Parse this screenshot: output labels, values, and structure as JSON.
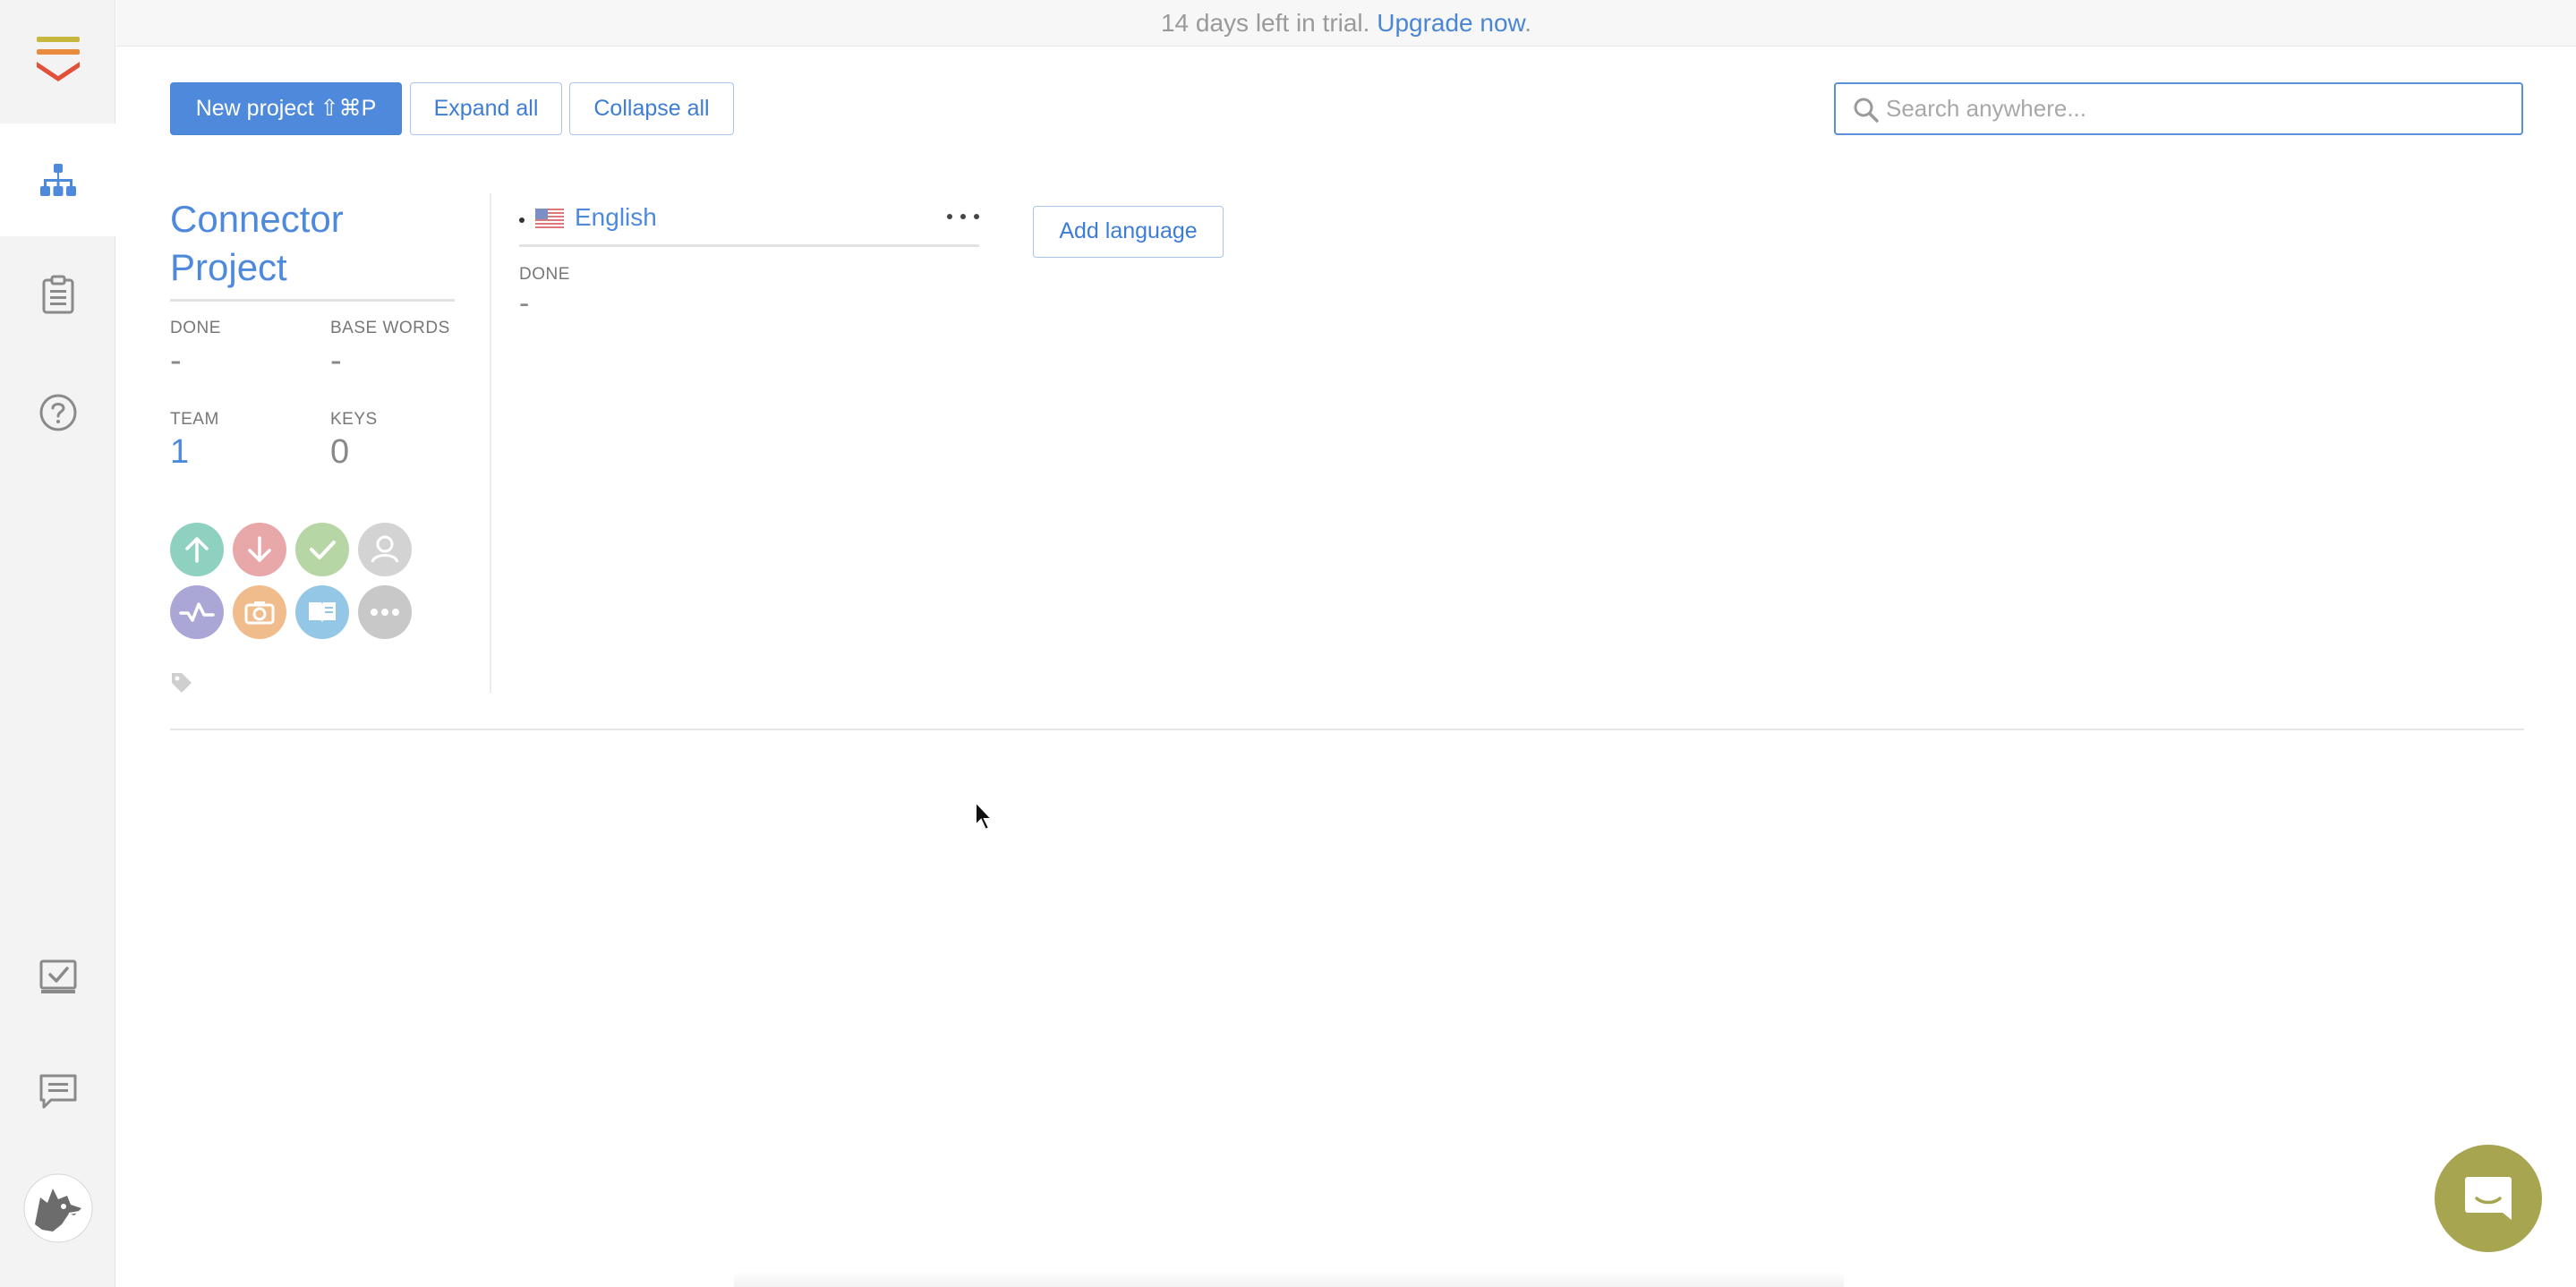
{
  "banner": {
    "trial_text": "14 days left in trial.",
    "upgrade_link": "Upgrade now",
    "trailing": "."
  },
  "toolbar": {
    "new_project_label": "New project ⇧⌘P",
    "expand_all_label": "Expand all",
    "collapse_all_label": "Collapse all"
  },
  "search": {
    "placeholder": "Search anywhere..."
  },
  "sidebar": {
    "items": [
      {
        "name": "projects",
        "icon": "sitemap-icon",
        "active": true
      },
      {
        "name": "orders",
        "icon": "clipboard-icon",
        "active": false
      },
      {
        "name": "help",
        "icon": "question-icon",
        "active": false
      },
      {
        "name": "tasks",
        "icon": "task-check-icon",
        "active": false
      },
      {
        "name": "chat",
        "icon": "message-icon",
        "active": false
      },
      {
        "name": "user",
        "icon": "avatar-icon",
        "active": false
      }
    ]
  },
  "project": {
    "title": "Connector Project",
    "stats": {
      "done_label": "DONE",
      "done_value": "-",
      "base_words_label": "BASE WORDS",
      "base_words_value": "-",
      "team_label": "TEAM",
      "team_value": "1",
      "keys_label": "KEYS",
      "keys_value": "0"
    },
    "actions": [
      "upload-icon",
      "download-icon",
      "review-check-icon",
      "contributor-icon",
      "activity-icon",
      "screenshots-icon",
      "glossary-icon",
      "more-icon"
    ],
    "languages": [
      {
        "name": "English",
        "flag": "us-flag-icon",
        "done_label": "DONE",
        "done_value": "-"
      }
    ],
    "add_language_label": "Add language"
  },
  "colors": {
    "accent": "#4f89dc",
    "sidebar_bg": "#f3f3f4",
    "chat_launcher": "#a8a551"
  }
}
